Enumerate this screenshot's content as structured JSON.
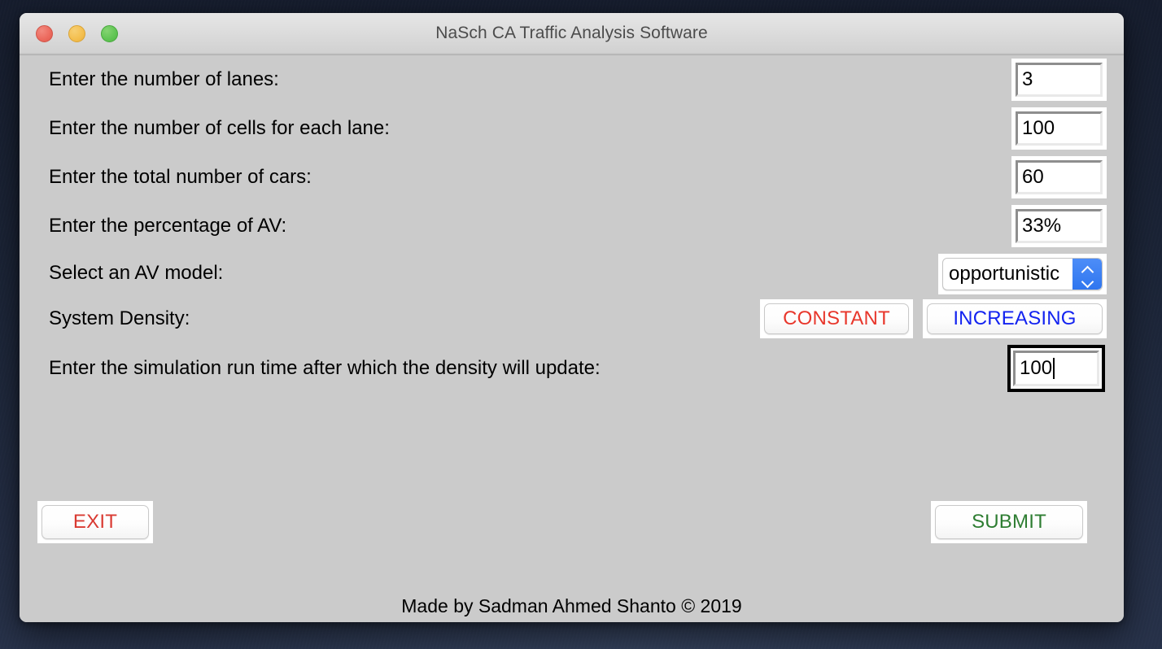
{
  "window": {
    "title": "NaSch CA Traffic Analysis Software",
    "traffic_lights": [
      {
        "name": "close",
        "color": "#ec6a5e"
      },
      {
        "name": "minimize",
        "color": "#f4bf4f"
      },
      {
        "name": "zoom",
        "color": "#61c554"
      }
    ]
  },
  "form": {
    "rows": [
      {
        "label": "Enter the number of lanes:",
        "value": "3"
      },
      {
        "label": "Enter the number of cells for each lane:",
        "value": "100"
      },
      {
        "label": "Enter the total number of cars:",
        "value": "60"
      },
      {
        "label": "Enter the percentage of AV:",
        "value": "33%"
      }
    ],
    "av_model": {
      "label": "Select an AV model:",
      "selected": "opportunistic",
      "stepper_icon": "chevron-up-down-icon"
    },
    "system_density": {
      "label": "System Density:",
      "constant_label": "CONSTANT",
      "constant_color": "#e8372c",
      "increasing_label": "INCREASING",
      "increasing_color": "#1323f0"
    },
    "run_time": {
      "label": "Enter the simulation run time after which the density will update:",
      "value": "100",
      "focused": true
    }
  },
  "actions": {
    "exit_label": "EXIT",
    "exit_color": "#d93a32",
    "submit_label": "SUBMIT",
    "submit_color": "#2e7d32"
  },
  "footer": {
    "credit": "Made by Sadman Ahmed Shanto © 2019"
  }
}
